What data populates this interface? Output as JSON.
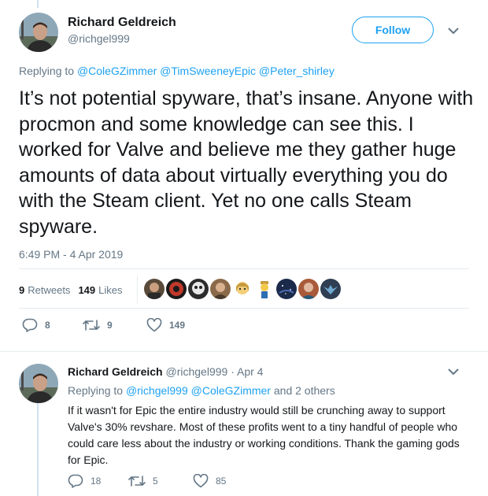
{
  "main_tweet": {
    "author": {
      "name": "Richard Geldreich",
      "handle": "@richgel999"
    },
    "follow_label": "Follow",
    "replying_prefix": "Replying to",
    "replying_mentions": [
      "@ColeGZimmer",
      "@TimSweeneyEpic",
      "@Peter_shirley"
    ],
    "text": "It’s not potential spyware, that’s insane. Anyone with procmon and some knowledge can see this. I worked for Valve and believe me they gather huge amounts of data about virtually everything you do with the Steam client. Yet no one calls Steam spyware.",
    "timestamp": "6:49 PM - 4 Apr 2019",
    "stats": {
      "retweets_count": "9",
      "retweets_label": "Retweets",
      "likes_count": "149",
      "likes_label": "Likes"
    },
    "liker_avatar_colors": [
      "#5a4a3a",
      "#c0392b",
      "#2c2c2c",
      "#8a6a4a",
      "#e0b060",
      "#f2c94c",
      "#1b2a4a",
      "#a85a3a",
      "#2f3e52"
    ],
    "actions": {
      "replies": "8",
      "retweets": "9",
      "likes": "149"
    }
  },
  "reply_tweet": {
    "author": {
      "name": "Richard Geldreich",
      "handle": "@richgel999"
    },
    "separator": "·",
    "date": "Apr 4",
    "replying_prefix": "Replying to",
    "replying_mentions": [
      "@richgel999",
      "@ColeGZimmer"
    ],
    "replying_suffix": "and 2 others",
    "text": "If it wasn't for Epic the entire industry would still be crunching away to support Valve's 30% revshare. Most of these profits went to a tiny handful of people who could care less about the industry or working conditions. Thank the gaming gods for Epic.",
    "actions": {
      "replies": "18",
      "retweets": "5",
      "likes": "85"
    }
  },
  "colors": {
    "accent": "#1da1f2",
    "muted": "#657786",
    "text": "#14171a",
    "border": "#e6ecf0",
    "thread_line": "#cfe3f3"
  }
}
